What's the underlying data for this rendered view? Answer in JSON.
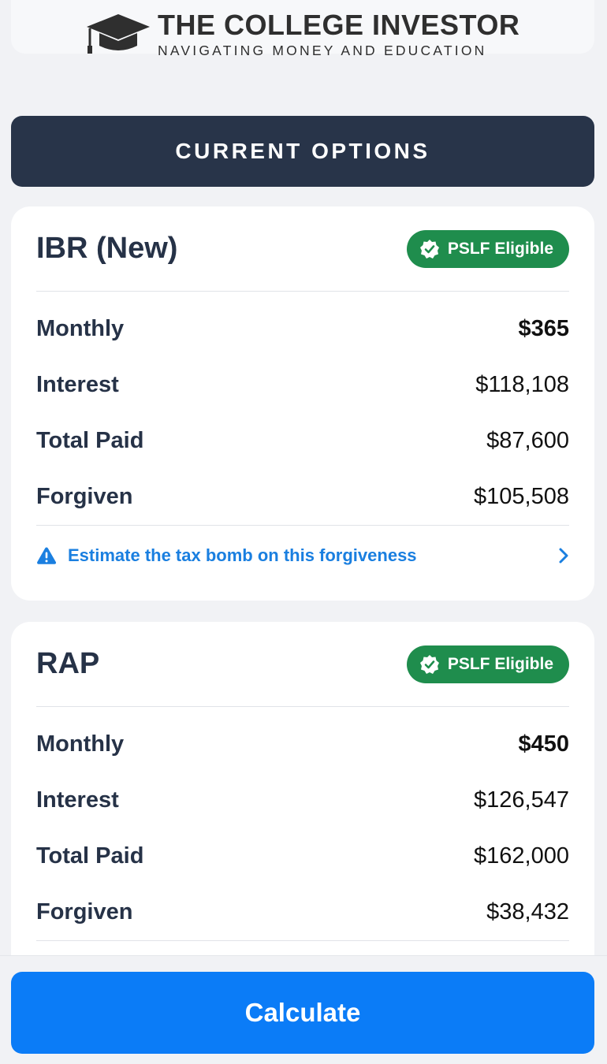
{
  "brand": {
    "title": "THE COLLEGE INVESTOR",
    "tagline": "NAVIGATING MONEY AND EDUCATION"
  },
  "section_title": "CURRENT OPTIONS",
  "plans": [
    {
      "name": "IBR (New)",
      "badge": "PSLF Eligible",
      "rows": [
        {
          "label": "Monthly",
          "value": "$365"
        },
        {
          "label": "Interest",
          "value": "$118,108"
        },
        {
          "label": "Total Paid",
          "value": "$87,600"
        },
        {
          "label": "Forgiven",
          "value": "$105,508"
        }
      ],
      "link": "Estimate the tax bomb on this forgiveness"
    },
    {
      "name": "RAP",
      "badge": "PSLF Eligible",
      "rows": [
        {
          "label": "Monthly",
          "value": "$450"
        },
        {
          "label": "Interest",
          "value": "$126,547"
        },
        {
          "label": "Total Paid",
          "value": "$162,000"
        },
        {
          "label": "Forgiven",
          "value": "$38,432"
        }
      ]
    }
  ],
  "calculate_label": "Calculate",
  "icons": {
    "logo": "graduation-cap-icon",
    "badge": "verified-check-icon",
    "warning": "warning-triangle-icon",
    "chevron": "chevron-right-icon"
  },
  "colors": {
    "banner": "#283449",
    "badge": "#1f8d4d",
    "link": "#1a7fe0",
    "button": "#0b7cf7"
  }
}
